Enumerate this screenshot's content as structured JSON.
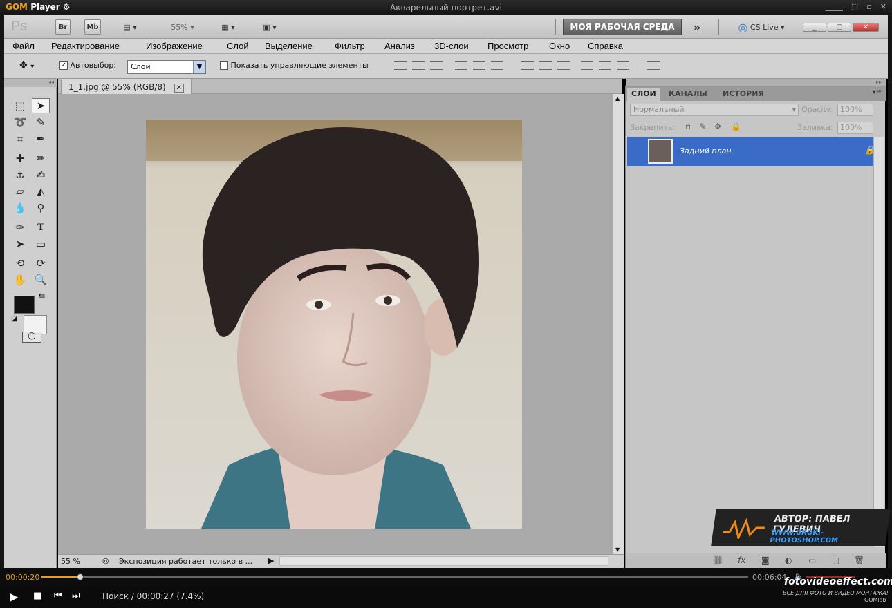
{
  "player": {
    "logo_gom": "GOM",
    "logo_player": "Player",
    "gear": "⚙",
    "title": "Акварельный портрет.avi",
    "current_time": "00:00:20",
    "total_time": "00:06:04",
    "progress": 0.055,
    "status_text": "Поиск / 00:00:27 (7.4%)",
    "brand": "fotovideoeffect.com",
    "tagline": "ВСЕ ДЛЯ ФОТО И ВИДЕО МОНТАЖА!",
    "gomlab": "GOMlab"
  },
  "appbar": {
    "logo": "Ps",
    "br": "Br",
    "mb": "Mb",
    "zoom": "55%",
    "workspace": "МОЯ РАБОЧАЯ СРЕДА",
    "more": "»",
    "cslive": "CS Live"
  },
  "menu": [
    "Файл",
    "Редактирование",
    "Изображение",
    "Слой",
    "Выделение",
    "Фильтр",
    "Анализ",
    "3D-слои",
    "Просмотр",
    "Окно",
    "Справка"
  ],
  "options": {
    "autoselect_label": "Автовыбор:",
    "autoselect_value": "Слой",
    "show_controls_label": "Показать управляющие элементы"
  },
  "document": {
    "tab_title": "1_1.jpg @ 55% (RGB/8)",
    "zoom_status": "55 %",
    "status_text": "Экспозиция работает только в ..."
  },
  "layers_panel": {
    "tabs": [
      "СЛОИ",
      "КАНАЛЫ",
      "ИСТОРИЯ"
    ],
    "blend_mode": "Нормальный",
    "opacity_label": "Opacity:",
    "opacity_value": "100%",
    "lock_label": "Закрепить:",
    "fill_label": "Заливка:",
    "fill_value": "100%",
    "layer_name": "Задний план"
  },
  "watermark": {
    "author": "АВТОР: ПАВЕЛ ГУЛЕВИЧ",
    "site": "WWW.UROKI-PHOTOSHOP.COM"
  }
}
